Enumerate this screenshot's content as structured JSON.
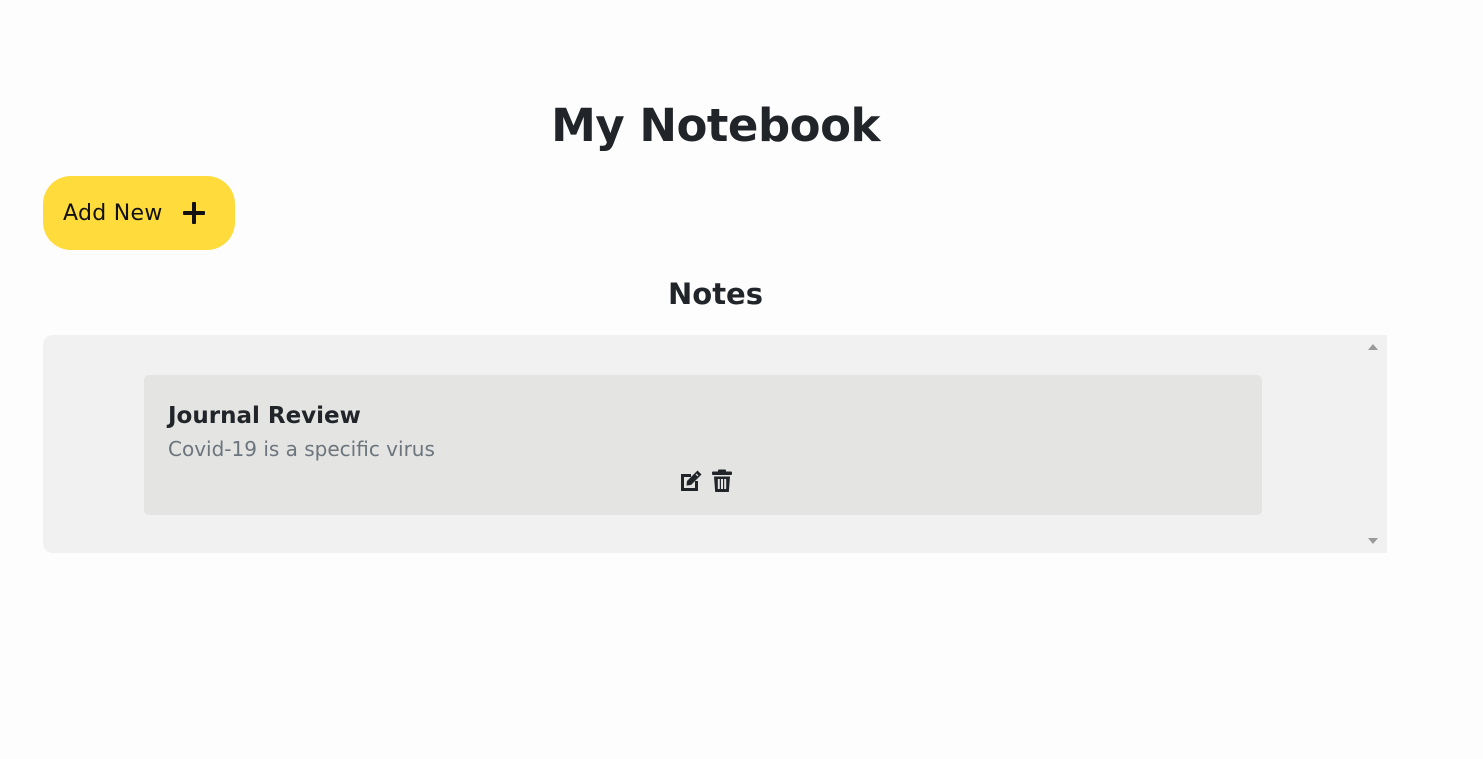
{
  "header": {
    "title": "My Notebook"
  },
  "toolbar": {
    "add_label": "Add New",
    "add_icon": "plus-icon",
    "accent_color": "#ffdb3c"
  },
  "notes_section": {
    "title": "Notes",
    "notes": [
      {
        "title": "Journal Review",
        "description": "Covid-19 is a specific virus",
        "actions": [
          "edit-icon",
          "trash-icon"
        ]
      }
    ]
  }
}
